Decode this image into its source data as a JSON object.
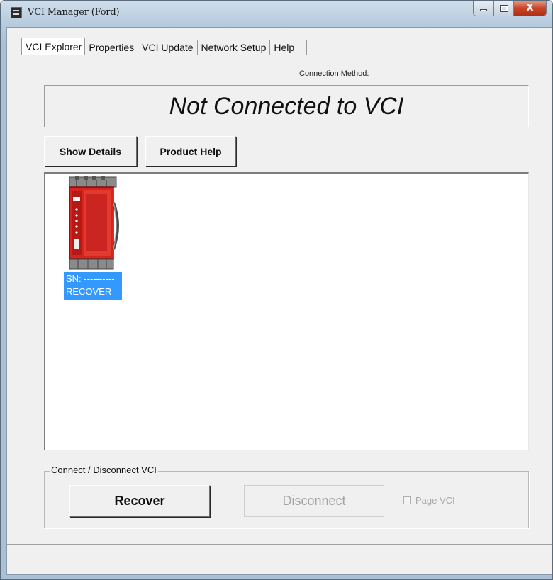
{
  "window": {
    "title": "VCI Manager (Ford)",
    "close_glyph": "X"
  },
  "tabs": [
    {
      "label": "VCI Explorer",
      "active": true
    },
    {
      "label": "Properties",
      "active": false
    },
    {
      "label": "VCI Update",
      "active": false
    },
    {
      "label": "Network Setup",
      "active": false
    },
    {
      "label": "Help",
      "active": false
    }
  ],
  "connection": {
    "method_label": "Connection Method:",
    "status_text": "Not Connected to VCI"
  },
  "toolbar": {
    "show_details_label": "Show Details",
    "product_help_label": "Product Help"
  },
  "devices": [
    {
      "sn_line": "SN: ----------",
      "name_line": "RECOVER",
      "selected": true,
      "icon": "vcm-device-icon"
    }
  ],
  "connect_group": {
    "legend": "Connect / Disconnect VCI",
    "recover_label": "Recover",
    "disconnect_label": "Disconnect",
    "disconnect_enabled": false,
    "page_vci_label": "Page VCI",
    "page_vci_checked": false,
    "page_vci_enabled": false
  },
  "colors": {
    "selection": "#3399ff",
    "device_red": "#d8231e",
    "title_bar": "#b9cde0"
  }
}
